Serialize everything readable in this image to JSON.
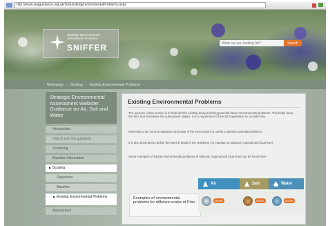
{
  "browser": {
    "address": "http://www.seaguidance.org.uk/10/ExistingEnvironmentalProblems.aspx"
  },
  "header": {
    "logo_subtitle": "Strategic Environmental Assessment Guidance",
    "logo_name": "SNIFFER",
    "search_placeholder": "What are you looking for?",
    "search_button": "Search"
  },
  "breadcrumb": [
    "Homepage",
    "Scoping",
    "Existing Environmental Problems"
  ],
  "sidebar": {
    "heading": "Strategic Environmental Assessment Website: Guidance on Air, Soil and Water",
    "items": [
      {
        "label": "Introduction",
        "style": "normal"
      },
      {
        "label": "How to use this guidance",
        "style": "italic"
      },
      {
        "label": "Screening",
        "style": "normal"
      },
      {
        "label": "Baseline Information",
        "style": "normal"
      },
      {
        "label": "Scoping",
        "style": "active"
      },
      {
        "label": "Objectives",
        "style": "sub"
      },
      {
        "label": "Baseline",
        "style": "sub"
      },
      {
        "label": "Existing Environmental Problems",
        "style": "sub2"
      },
      {
        "label": "Assessment",
        "style": "normal"
      }
    ]
  },
  "main": {
    "title": "Existing Environmental Problems",
    "paragraphs": [
      "The purpose of this section is to help identify existing and predicting potential future environmental problems. This helps focus the SEA and streamline the subsequent stages. It is a requirement of the SEA legislation to consider this.",
      "Referring to the current legislation and state of the environment is useful to identify potential problems.",
      "It is also important to define the level of detail of the problems, for example at national, regional and local level.",
      "Some examples of topical environmental problems at national, regional and local level can be found here."
    ],
    "examples_label": "Examples of environmental problems for different scales of Plan",
    "topics": [
      {
        "label": "Air",
        "color": "#3f8fbf",
        "more": "MORE"
      },
      {
        "label": "Soil",
        "color": "#a59a62",
        "more": "MORE"
      },
      {
        "label": "Water",
        "color": "#4d8fb8",
        "more": "MORE"
      }
    ]
  },
  "colors": {
    "accent": "#e4732a",
    "sidebar_head": "#7d8b7e",
    "panel": "#eef0ee"
  }
}
